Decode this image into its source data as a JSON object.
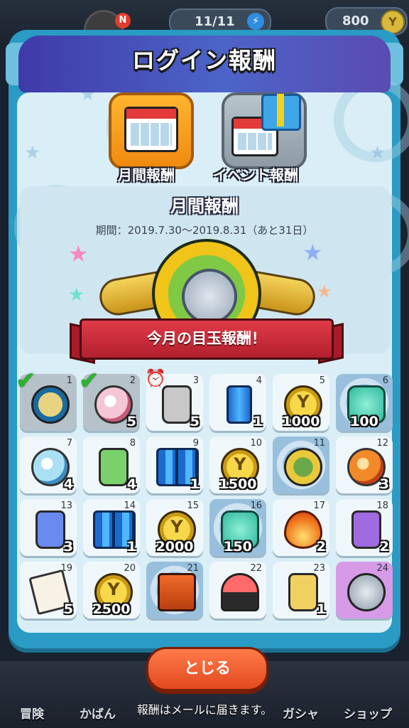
{
  "hud": {
    "stamina": "11/11",
    "money": "800",
    "notification_badge": "N"
  },
  "modal": {
    "title": "ログイン報酬",
    "tabs": [
      {
        "label": "月間報酬",
        "active": true
      },
      {
        "label": "イベント報酬",
        "active": false
      }
    ],
    "section_title": "月間報酬",
    "period": "期間：2019.7.30〜2019.8.31（あと31日）",
    "featured_banner": "今月の目玉報酬！",
    "close_label": "とじる",
    "footer_note": "報酬はメールに届きます。"
  },
  "rewards": [
    {
      "day": "1",
      "qty": "",
      "icon": "star-coin-icon",
      "claimed": true
    },
    {
      "day": "2",
      "qty": "5",
      "icon": "pink-orb-icon",
      "claimed": true
    },
    {
      "day": "3",
      "qty": "5",
      "icon": "e-bottle-icon",
      "timer": true
    },
    {
      "day": "4",
      "qty": "1",
      "icon": "battery-icon"
    },
    {
      "day": "5",
      "qty": "1000",
      "icon": "y-coin-icon"
    },
    {
      "day": "6",
      "qty": "100",
      "icon": "jade-coin-icon",
      "special": true
    },
    {
      "day": "7",
      "qty": "4",
      "icon": "blue-orb-icon"
    },
    {
      "day": "8",
      "qty": "4",
      "icon": "d-bottle-icon"
    },
    {
      "day": "9",
      "qty": "1",
      "icon": "double-battery-icon"
    },
    {
      "day": "10",
      "qty": "1500",
      "icon": "y-coin-icon"
    },
    {
      "day": "11",
      "qty": "",
      "icon": "crest-coin-icon",
      "special": true
    },
    {
      "day": "12",
      "qty": "3",
      "icon": "orange-orb-icon"
    },
    {
      "day": "13",
      "qty": "3",
      "icon": "c-bottle-icon"
    },
    {
      "day": "14",
      "qty": "1",
      "icon": "battery-pack-icon"
    },
    {
      "day": "15",
      "qty": "2000",
      "icon": "y-coin-icon"
    },
    {
      "day": "16",
      "qty": "150",
      "icon": "jade-coin-icon",
      "special": true
    },
    {
      "day": "17",
      "qty": "2",
      "icon": "flame-orb-icon"
    },
    {
      "day": "18",
      "qty": "2",
      "icon": "b-bottle-icon"
    },
    {
      "day": "19",
      "qty": "5",
      "icon": "ticket-icon"
    },
    {
      "day": "20",
      "qty": "2500",
      "icon": "y-coin-icon"
    },
    {
      "day": "21",
      "qty": "",
      "icon": "treasure-box-icon",
      "special": true
    },
    {
      "day": "22",
      "qty": "",
      "icon": "gacha-machine-icon"
    },
    {
      "day": "23",
      "qty": "1",
      "icon": "a-bottle-icon"
    },
    {
      "day": "24",
      "qty": "",
      "icon": "silver-coin-icon",
      "finale": true
    }
  ],
  "bottom_nav": [
    {
      "label": "冒険"
    },
    {
      "label": "かばん"
    },
    {
      "label": "ガシャ"
    },
    {
      "label": "ショップ"
    }
  ],
  "colors": {
    "frame": "#2a9bc4",
    "header": "#4c64c8",
    "active_tab": "#f5a020",
    "banner": "#c92a38",
    "close_button": "#f25a2a"
  }
}
